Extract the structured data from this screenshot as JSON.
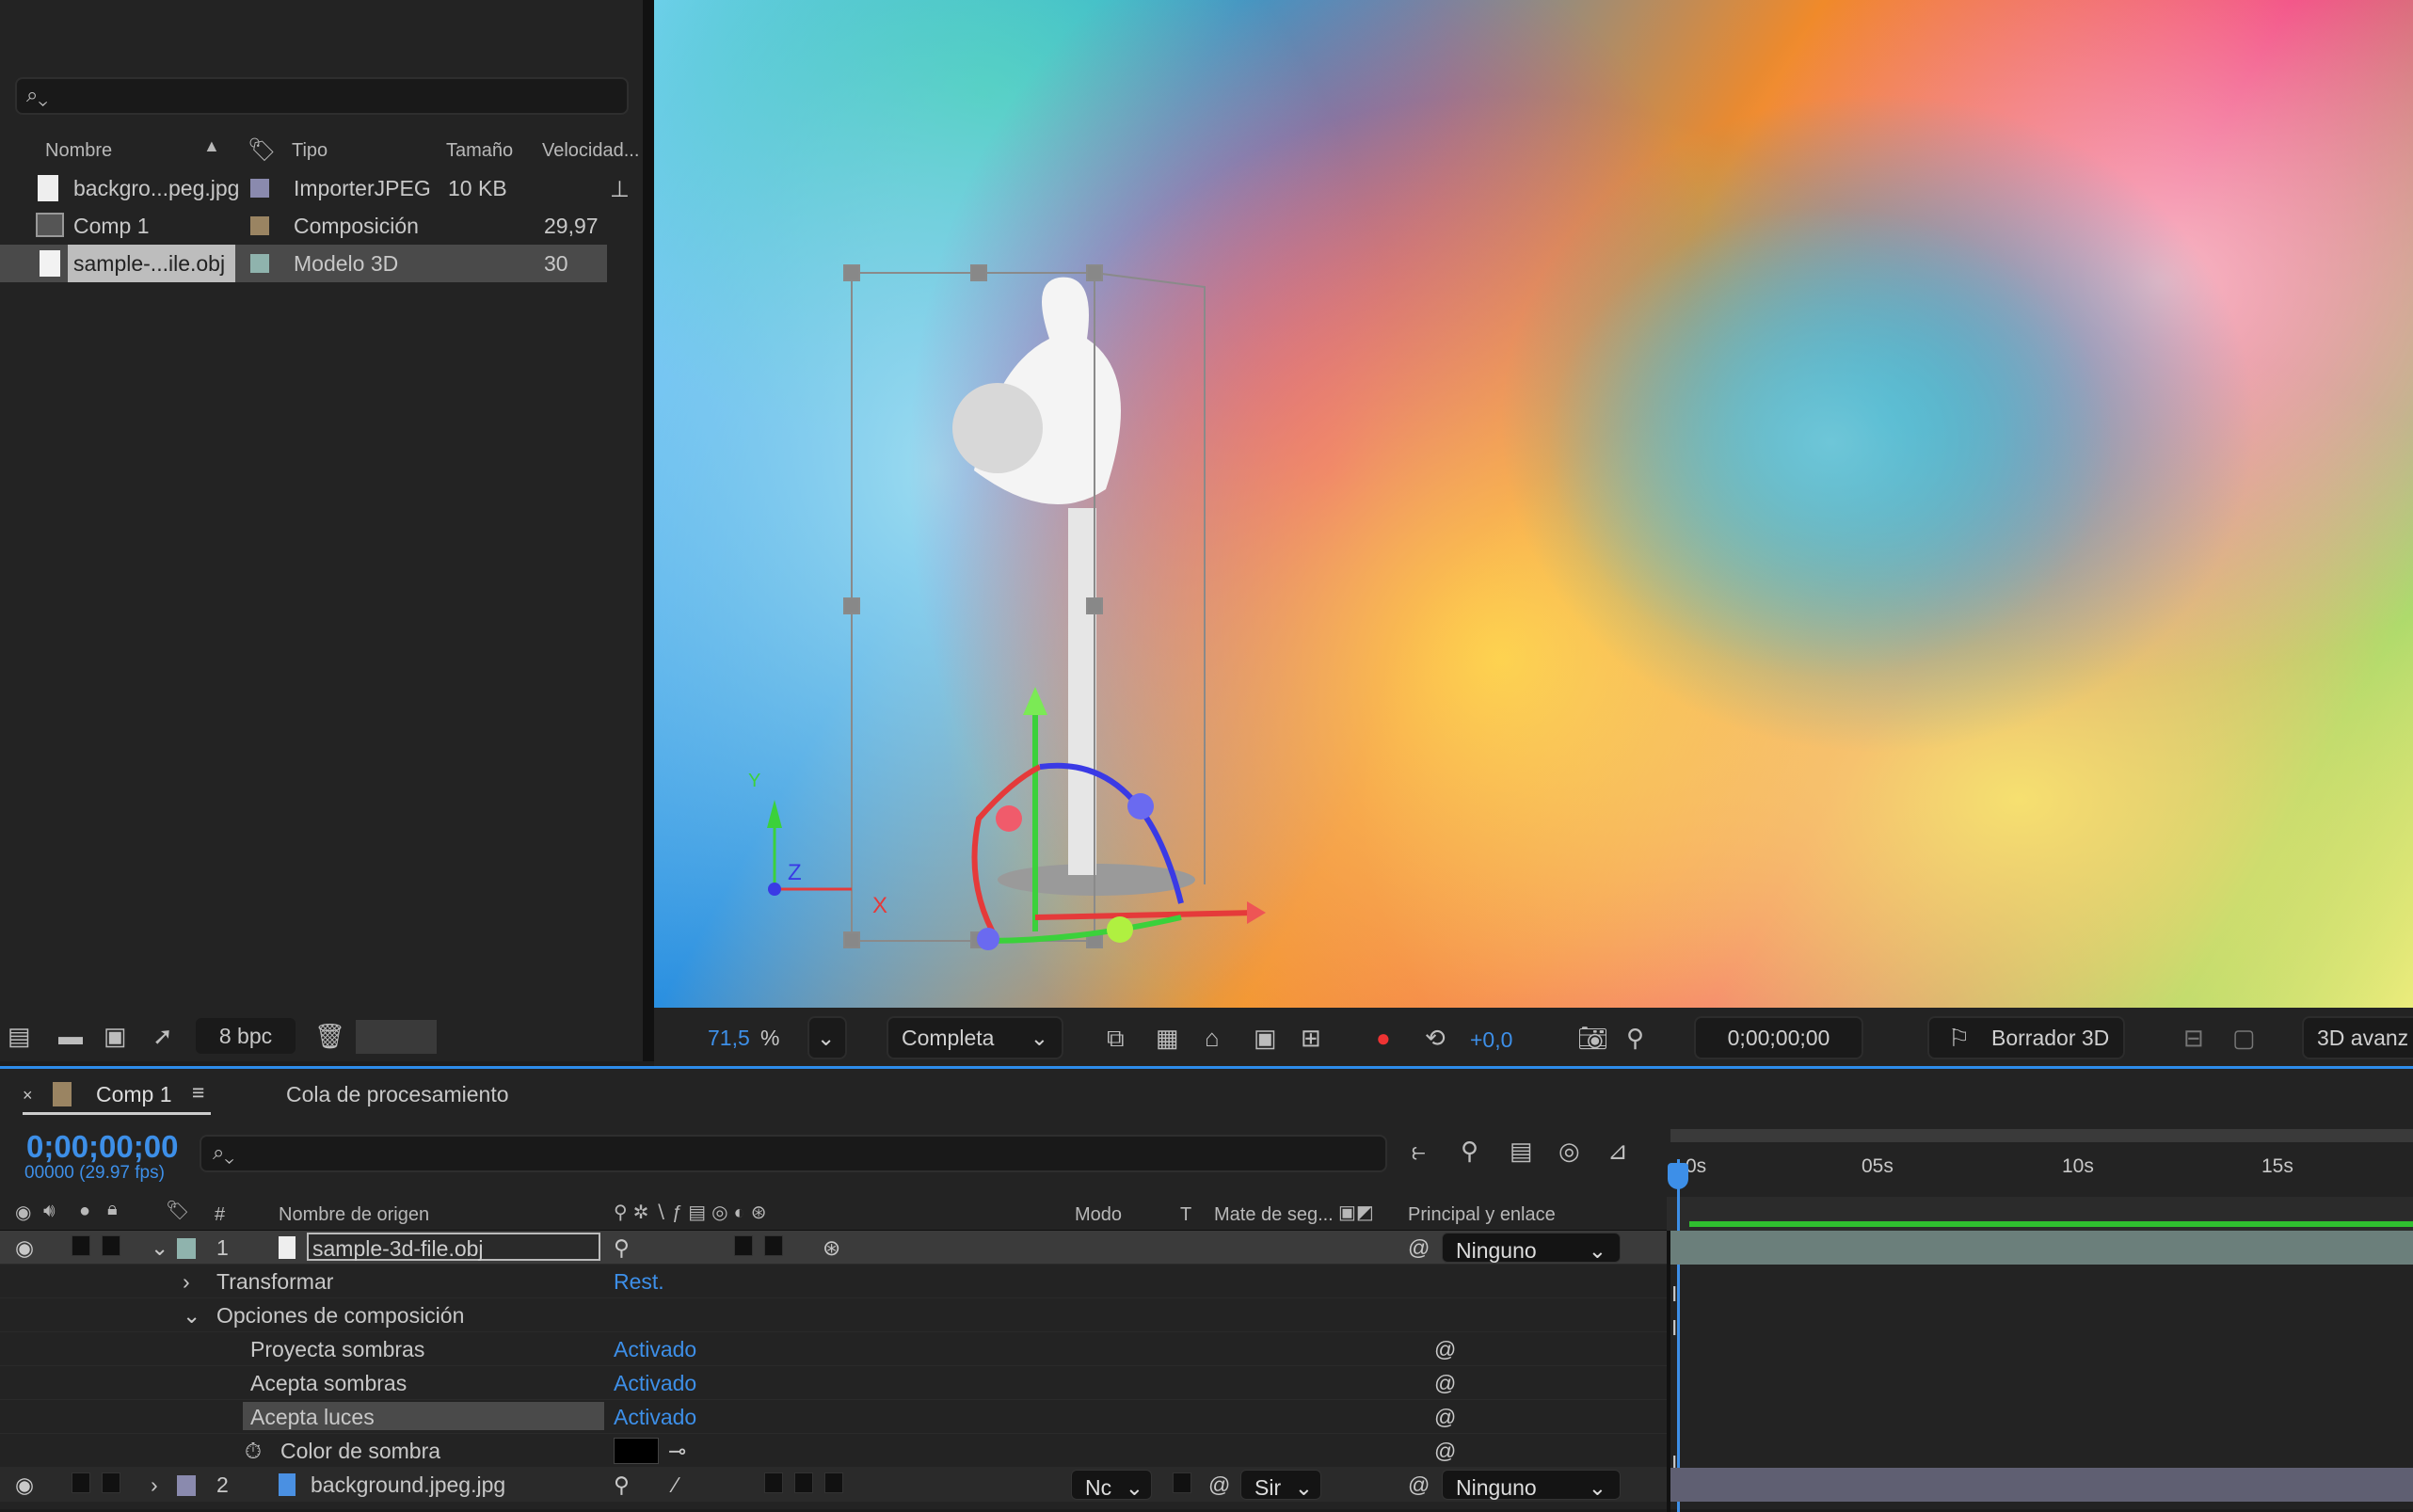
{
  "project": {
    "search_placeholder": "",
    "columns": {
      "name": "Nombre",
      "type": "Tipo",
      "size": "Tamaño",
      "speed": "Velocidad..."
    },
    "items": [
      {
        "name": "backgro...peg.jpg",
        "type": "ImporterJPEG",
        "size": "10 KB",
        "speed": "",
        "label_color": "#8a8aae",
        "icon": "image-file-icon"
      },
      {
        "name": "Comp 1",
        "type": "Composición",
        "size": "",
        "speed": "29,97",
        "label_color": "#9a8462",
        "icon": "composition-icon"
      },
      {
        "name": "sample-...ile.obj",
        "type": "Modelo 3D",
        "size": "",
        "speed": "30",
        "label_color": "#8fb3ad",
        "icon": "file-icon",
        "selected": true
      }
    ],
    "footer": {
      "bpc": "8 bpc"
    }
  },
  "viewer": {
    "axis_labels": {
      "x": "X",
      "y": "Y",
      "z": "Z"
    },
    "toolbar": {
      "zoom": "71,5",
      "zoom_unit": "%",
      "resolution": "Completa",
      "exposure": "+0,0",
      "timecode": "0;00;00;00",
      "renderer": "Borrador 3D",
      "mode": "3D avanz"
    }
  },
  "timeline": {
    "tabs": [
      {
        "label": "Comp 1",
        "color": "#9a8462"
      },
      {
        "label": "Cola de procesamiento"
      }
    ],
    "timecode": "0;00;00;00",
    "frame_info": "00000 (29.97 fps)",
    "columns": {
      "num": "#",
      "source": "Nombre de origen",
      "mode": "Modo",
      "t": "T",
      "matte": "Mate de seg...",
      "parent": "Principal y enlace"
    },
    "ruler": [
      "0s",
      "05s",
      "10s",
      "15s"
    ],
    "layers": [
      {
        "num": "1",
        "name": "sample-3d-file.obj",
        "parent": "Ninguno",
        "color": "#8fb3ad"
      },
      {
        "num": "2",
        "name": "background.jpeg.jpg",
        "parent": "Ninguno",
        "mode": "Nc",
        "matte": "Sir",
        "color": "#8a8aae"
      }
    ],
    "properties": {
      "transform": "Transformar",
      "transform_value": "Rest.",
      "options": "Opciones de composición",
      "casts_shadows": "Proyecta sombras",
      "casts_shadows_value": "Activado",
      "accepts_shadows": "Acepta sombras",
      "accepts_shadows_value": "Activado",
      "accepts_lights": "Acepta luces",
      "accepts_lights_value": "Activado",
      "shadow_color": "Color de sombra",
      "shadow_color_value": "#000000"
    }
  }
}
